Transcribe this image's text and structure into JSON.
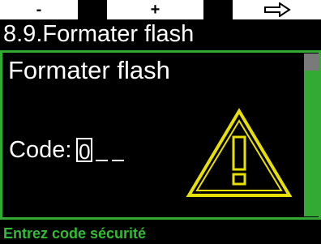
{
  "softkeys": {
    "left_label": "-",
    "middle_label": "+",
    "right_icon": "right-arrow-icon"
  },
  "page": {
    "title": "8.9.Formater flash"
  },
  "panel": {
    "heading": "Formater flash",
    "code_label": "Code:",
    "code_digits": [
      "0",
      "",
      ""
    ],
    "warning_icon": "warning-triangle-icon"
  },
  "footer": {
    "hint": "Entrez code sécurité"
  },
  "colors": {
    "frame_green": "#33aa33",
    "warning_yellow": "#e8e000",
    "scroll_thumb": "#7a7a7a"
  }
}
